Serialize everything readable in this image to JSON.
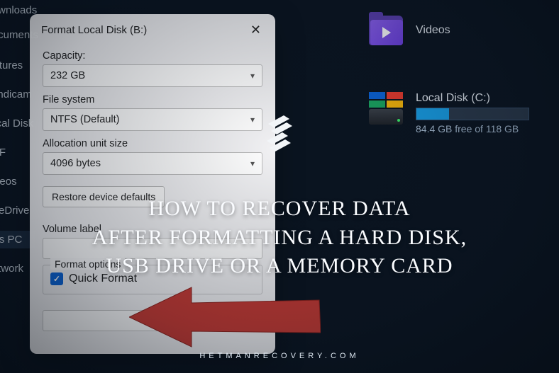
{
  "sidebar": {
    "items": [
      {
        "label": "Downloads"
      },
      {
        "label": "Documents"
      },
      {
        "label": "Pictures"
      },
      {
        "label": "Bandicam"
      },
      {
        "label": "Local Disk"
      },
      {
        "label": "PDF"
      },
      {
        "label": "Videos"
      },
      {
        "label": "OneDrive"
      },
      {
        "label": "This PC"
      },
      {
        "label": "Network"
      }
    ]
  },
  "dialog": {
    "title": "Format Local Disk (B:)",
    "capacity_label": "Capacity:",
    "capacity_value": "232 GB",
    "filesystem_label": "File system",
    "filesystem_value": "NTFS (Default)",
    "allocation_label": "Allocation unit size",
    "allocation_value": "4096 bytes",
    "restore_defaults": "Restore device defaults",
    "volume_label": "Volume label",
    "format_options": "Format options",
    "quick_format": "Quick Format"
  },
  "explorer": {
    "videos_label": "Videos",
    "disk_label": "Local Disk (C:)",
    "disk_free": "84.4 GB free of 118 GB"
  },
  "overlay": {
    "headline_l1": "HOW TO RECOVER DATA",
    "headline_l2": "AFTER FORMATTING A HARD DISK,",
    "headline_l3": "USB DRIVE OR A MEMORY CARD",
    "site": "HETMANRECOVERY.COM"
  }
}
